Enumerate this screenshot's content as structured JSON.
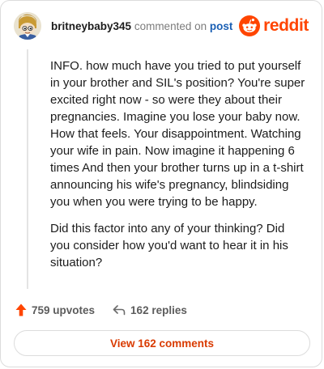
{
  "comment": {
    "username": "britneybaby345",
    "action": "commented on",
    "target": "post",
    "avatar_icon": "cartoon-avatar-icon",
    "paragraphs": [
      "INFO. how much have you tried to put yourself in your brother and SIL's position? You're super excited right now - so were they about their pregnancies. Imagine you lose your baby now. How that feels. Your disappointment. Watching your wife in pain. Now imagine it happening 6 times And then your brother turns up in a t-shirt announcing his wife's pregnancy, blindsiding you when you were trying to be happy.",
      "Did this factor into any of your thinking? Did you consider how you'd want to hear it in his situation?"
    ]
  },
  "brand": {
    "name": "reddit",
    "logo_icon": "reddit-snoo-icon",
    "color": "#ff4500"
  },
  "footer": {
    "upvotes_label": "759 upvotes",
    "upvote_icon": "upvote-arrow-icon",
    "upvote_color": "#ff4500",
    "replies_label": "162 replies",
    "reply_icon": "reply-arrow-icon"
  },
  "view_button": {
    "label": "View 162 comments",
    "color": "#d93a00"
  }
}
